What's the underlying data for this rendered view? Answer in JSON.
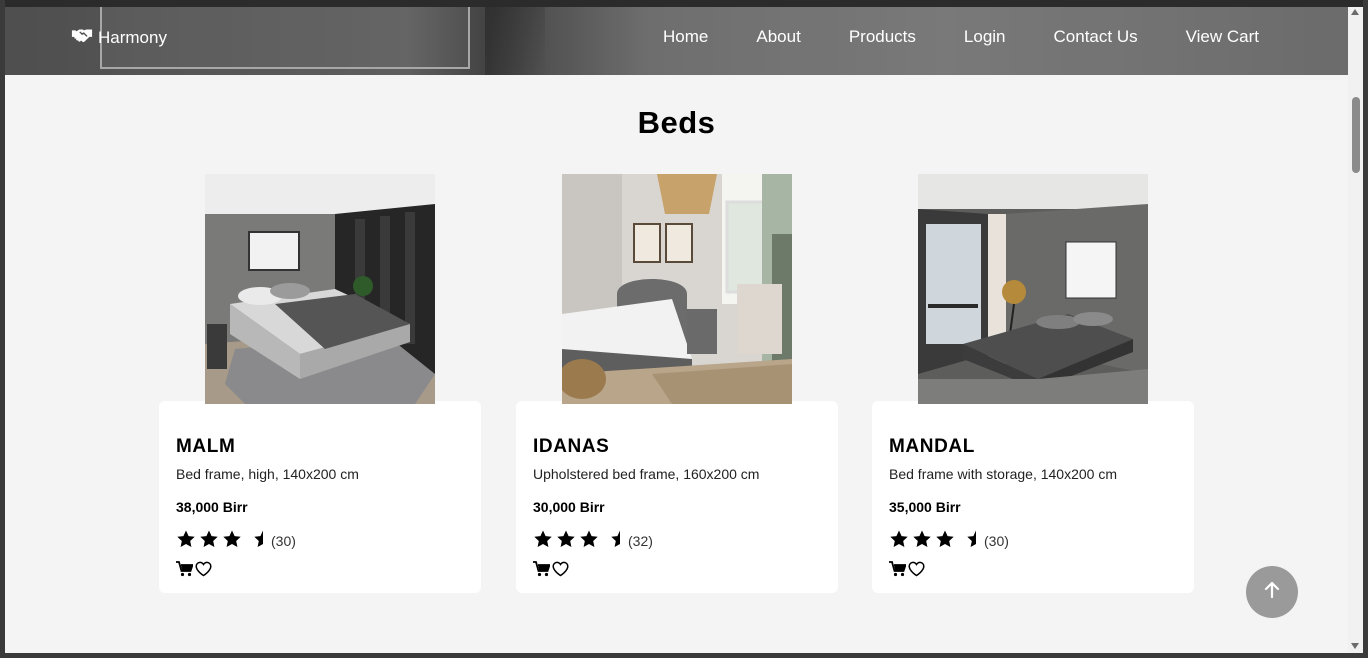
{
  "header": {
    "logo_text": "Harmony",
    "nav": [
      "Home",
      "About",
      "Products",
      "Login",
      "Contact Us",
      "View Cart"
    ]
  },
  "section": {
    "title": "Beds"
  },
  "products": [
    {
      "name": "MALM",
      "description": "Bed frame, high, 140x200 cm",
      "price": "38,000 Birr",
      "rating_count": "(30)",
      "rating": 3.5
    },
    {
      "name": "IDANAS",
      "description": "Upholstered bed frame, 160x200 cm",
      "price": "30,000 Birr",
      "rating_count": "(32)",
      "rating": 3.5
    },
    {
      "name": "MANDAL",
      "description": "Bed frame with storage, 140x200 cm",
      "price": "35,000 Birr",
      "rating_count": "(30)",
      "rating": 3.5
    }
  ],
  "icons": {
    "logo": "handshake-icon",
    "star": "star-icon",
    "cart": "cart-icon",
    "wishlist": "heart-icon",
    "to_top": "arrow-up-icon"
  },
  "colors": {
    "background": "#f4f4f4",
    "card": "#ffffff",
    "to_top_button": "#9a9a9a"
  }
}
